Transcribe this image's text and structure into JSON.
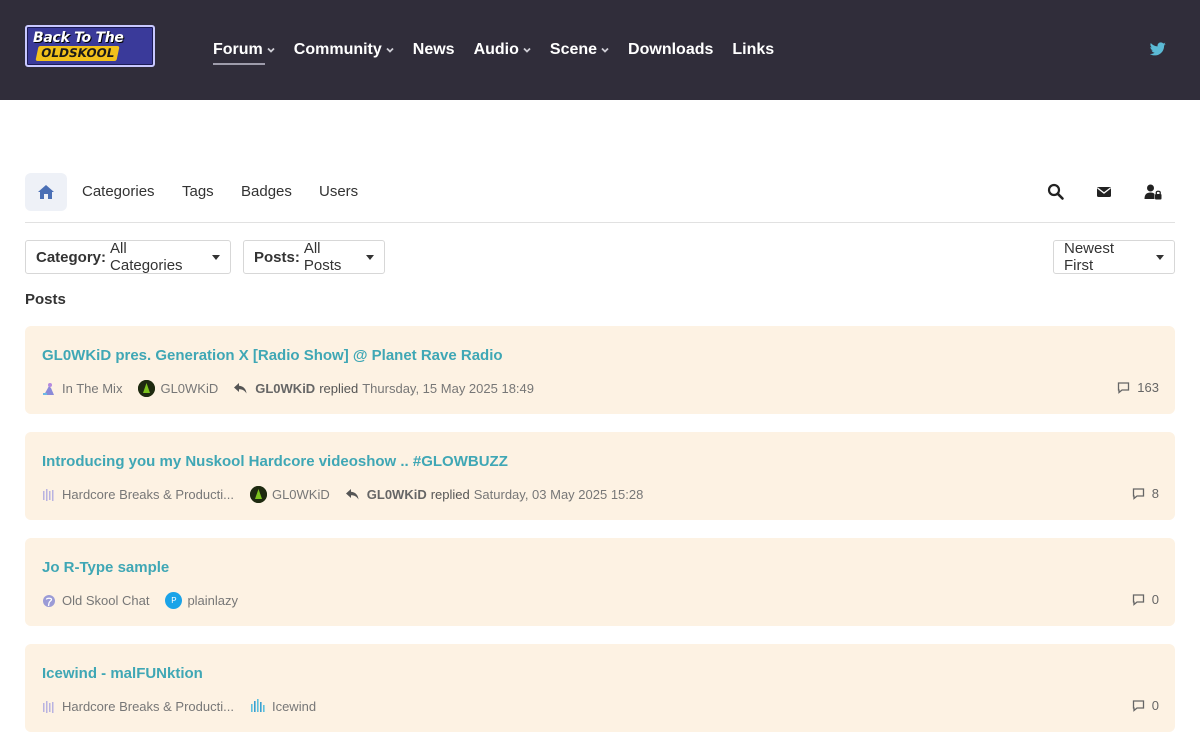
{
  "header": {
    "logo_line1": "Back To The",
    "logo_line2": "OLDSKOOL",
    "nav": [
      {
        "label": "Forum",
        "dropdown": true,
        "active": true
      },
      {
        "label": "Community",
        "dropdown": true
      },
      {
        "label": "News",
        "dropdown": false
      },
      {
        "label": "Audio",
        "dropdown": true
      },
      {
        "label": "Scene",
        "dropdown": true
      },
      {
        "label": "Downloads",
        "dropdown": false
      },
      {
        "label": "Links",
        "dropdown": false
      }
    ],
    "social_icon": "twitter-icon"
  },
  "forum_nav": {
    "tabs": [
      "Categories",
      "Tags",
      "Badges",
      "Users"
    ],
    "icons": [
      "home-icon",
      "search-icon",
      "envelope-icon",
      "user-lock-icon"
    ]
  },
  "filters": {
    "category_label": "Category:",
    "category_value": "All Categories",
    "posts_label": "Posts:",
    "posts_value": "All Posts",
    "sort_value": "Newest First"
  },
  "section_title": "Posts",
  "posts": [
    {
      "title": "GL0WKiD pres. Generation X [Radio Show] @ Planet Rave Radio",
      "category": "In The Mix",
      "author": "GL0WKiD",
      "replier": "GL0WKiD",
      "reply_text": "replied",
      "reply_time": "Thursday, 15 May 2025 18:49",
      "count": "163"
    },
    {
      "title": "Introducing you my Nuskool Hardcore videoshow .. #GLOWBUZZ",
      "category": "Hardcore Breaks & Producti...",
      "author": "GL0WKiD",
      "replier": "GL0WKiD",
      "reply_text": "replied",
      "reply_time": "Saturday, 03 May 2025 15:28",
      "count": "8"
    },
    {
      "title": "Jo R-Type sample",
      "category": "Old Skool Chat",
      "author": "plainlazy",
      "avatar_letter": "P",
      "count": "0"
    },
    {
      "title": "Icewind - malFUNktion",
      "category": "Hardcore Breaks & Producti...",
      "author": "Icewind",
      "count": "0"
    }
  ],
  "colors": {
    "header_bg": "#302d3a",
    "card_bg": "#fdf2e3",
    "title_link": "#3fa7b5",
    "twitter": "#5bbad5",
    "home_icon": "#4a6fb5"
  }
}
